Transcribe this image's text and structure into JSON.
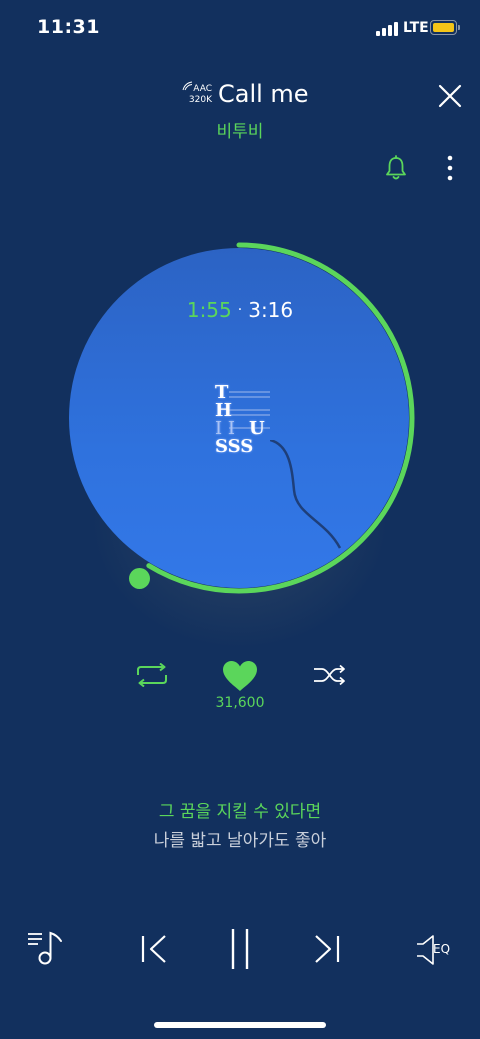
{
  "status_bar": {
    "time": "11:31",
    "network": "LTE"
  },
  "header": {
    "codec": "AAC",
    "bitrate": "320K",
    "title": "Call me",
    "artist": "비투비"
  },
  "player": {
    "elapsed": "1:55",
    "separator": "·",
    "duration": "3:16",
    "progress": 0.587,
    "album_art_text": [
      "T",
      "H",
      "I  I",
      "U",
      "SSS"
    ]
  },
  "actions": {
    "like_count": "31,600"
  },
  "lyrics": {
    "current": "그 꿈을 지킬 수 있다면",
    "next": "나를 밟고 날아가도 좋아"
  },
  "controls": {
    "eq_label": "EQ"
  },
  "colors": {
    "background": "#12305e",
    "accent_green": "#5bd65b",
    "disc_blue": "#2f72de"
  }
}
